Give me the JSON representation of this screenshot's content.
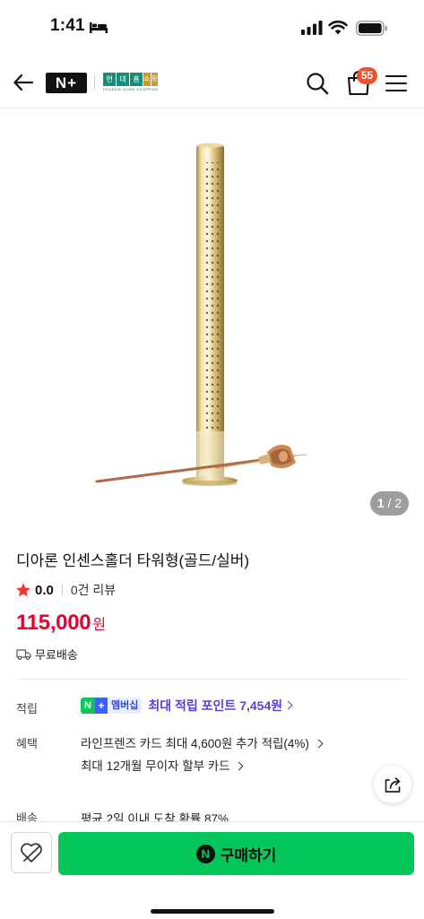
{
  "status_bar": {
    "time": "1:41",
    "battery": "full"
  },
  "header": {
    "naver_logo_text": "N+",
    "shop_logo_chars": [
      "현",
      "대",
      "홈",
      "쇼",
      "핑"
    ],
    "shop_logo_subtext": "HYUNDAI HOME SHOPPING",
    "cart_count": "55"
  },
  "gallery": {
    "current": "1",
    "separator": "/",
    "total": "2"
  },
  "product": {
    "title": "디아론 인센스홀더 타워형(골드/실버)",
    "rating": "0.0",
    "review_count": "0건 리뷰",
    "price": "115,000",
    "price_unit": "원",
    "shipping": "무료배송"
  },
  "points": {
    "label": "적립",
    "badge_n": "N",
    "badge_plus": "+",
    "badge_text": "멤버십",
    "text": "최대 적립 포인트 7,454원"
  },
  "benefits": {
    "label": "혜택",
    "lines": [
      "라인프렌즈 카드 최대 4,600원 추가 적립(4%)",
      "최대 12개월 무이자 할부 카드"
    ]
  },
  "delivery": {
    "label": "배송",
    "text": "평균 2일 이내 도착 확률 87%"
  },
  "bottom_bar": {
    "buy_label": "구매하기",
    "buy_logo": "N"
  },
  "colors": {
    "price_red": "#e6002d",
    "naver_green": "#03c75a",
    "membership_purple": "#5b3de0",
    "badge_orange": "#f0502a",
    "shop_teal": "#1a8c7a",
    "shop_gold": "#c99a2e"
  }
}
